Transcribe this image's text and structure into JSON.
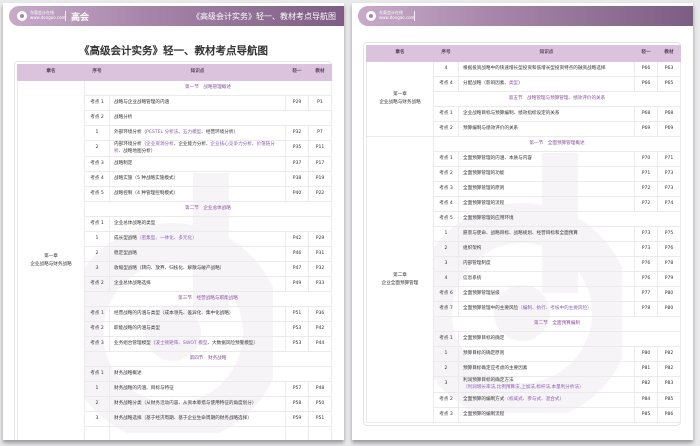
{
  "brand": {
    "logo_text": "东奥会计在线",
    "logo_url_text": "www.dongao.com",
    "level": "高会"
  },
  "header_title": "《高级会计实务》轻一、教材考点导航图",
  "doc_title": "《高级会计实务》轻一、教材考点导航图",
  "columns": [
    "章名",
    "序号",
    "知识点",
    "轻一",
    "教材"
  ],
  "colors": {
    "accent": "#8c5cb5",
    "header_bg": "#dcc3dd"
  },
  "left_page": {
    "chapters": [
      {
        "name": "第一章",
        "sub": "企业战略与财务战略",
        "rows": [
          {
            "sec": "第一节　战略管理概述"
          },
          {
            "n": "考点 1",
            "t": [
              {
                "s": "战略与企业战略管理的内涵"
              }
            ],
            "a": "P29",
            "b": "P1"
          },
          {
            "n": "考点 2",
            "t": [
              {
                "s": "战略分析"
              }
            ]
          },
          {
            "n": "1",
            "t": [
              {
                "s": "外部环境分析（"
              },
              {
                "s": "PESTEL 分析法",
                "h": 1
              },
              {
                "s": "、"
              },
              {
                "s": "五力模型",
                "h": 1
              },
              {
                "s": "、经营环境分析）"
              }
            ],
            "a": "P32",
            "b": "P7"
          },
          {
            "n": "2",
            "t": [
              {
                "s": "内部环境分析（"
              },
              {
                "s": "企业资源分析",
                "h": 1
              },
              {
                "s": "、企业能力分析、"
              },
              {
                "s": "企业核心竞争力分析",
                "h": 1
              },
              {
                "s": "、"
              },
              {
                "s": "价值链分析",
                "h": 1
              },
              {
                "s": "、战略地图分析）"
              }
            ],
            "a": "P35",
            "b": "P11"
          },
          {
            "n": "考点 3",
            "t": [
              {
                "s": "战略制定"
              }
            ],
            "a": "P37",
            "b": "P17"
          },
          {
            "n": "考点 4",
            "t": [
              {
                "s": "战略实施（5 种战略实施模式）"
              }
            ],
            "a": "P38",
            "b": "P19"
          },
          {
            "n": "考点 5",
            "t": [
              {
                "s": "战略控制（4 种管理控制模式）"
              }
            ],
            "a": "P40",
            "b": "P22"
          },
          {
            "sec": "第二节　企业总体战略"
          },
          {
            "n": "考点 1",
            "t": [
              {
                "s": "企业总体战略的类型"
              }
            ]
          },
          {
            "n": "1",
            "t": [
              {
                "s": "成长型战略"
              },
              {
                "s": "（密集型、一体化、多元化）",
                "h": 1
              }
            ],
            "a": "P42",
            "b": "P29"
          },
          {
            "n": "2",
            "t": [
              {
                "s": "稳定型战略"
              }
            ],
            "a": "P46",
            "b": "P31"
          },
          {
            "n": "3",
            "t": [
              {
                "s": "收缩型战略（转向、放弃、归核化、解散与破产战略）"
              }
            ],
            "a": "P47",
            "b": "P32"
          },
          {
            "n": "考点 2",
            "t": [
              {
                "s": "企业总体战略选择"
              }
            ],
            "a": "P49",
            "b": "P33"
          },
          {
            "sec": "第三节　经营战略与职能战略"
          },
          {
            "n": "考点 1",
            "t": [
              {
                "s": "经营战略的内涵与类型（成本领先、差异化、集中化战略）"
              }
            ],
            "a": "P51",
            "b": "P36"
          },
          {
            "n": "考点 2",
            "t": [
              {
                "s": "职能战略的内涵与类型"
              }
            ],
            "a": "P53",
            "b": "P42"
          },
          {
            "n": "考点 3",
            "t": [
              {
                "s": "业务组合管理模型（"
              },
              {
                "s": "波士顿矩阵、SWOT 模型",
                "h": 1
              },
              {
                "s": "、大数据风险预警模型）"
              }
            ],
            "a": "P53",
            "b": "P44"
          },
          {
            "sec": "第四节　财务战略"
          },
          {
            "n": "考点 1",
            "t": [
              {
                "s": "财务战略概述"
              }
            ]
          },
          {
            "n": "1",
            "t": [
              {
                "s": "财务战略的内涵、目标与特征"
              }
            ],
            "a": "P57",
            "b": "P48"
          },
          {
            "n": "2",
            "t": [
              {
                "s": "财务战略分类（从财务活动内容、从资本筹措与使用特征的角度划分）"
              }
            ],
            "a": "P58",
            "b": "P50"
          },
          {
            "n": "3",
            "t": [
              {
                "s": "财务战略选择（基于经济周期、基于企业生命周期的财务战略选择）"
              }
            ],
            "a": "P59",
            "b": "P51"
          },
          {
            "n": "",
            "t": [
              {
                "s": ""
              }
            ],
            "a": "",
            "b": ""
          }
        ]
      }
    ]
  },
  "right_page": {
    "chapters": [
      {
        "name": "第一章",
        "sub": "企业战略与财务战略",
        "rows": [
          {
            "n": "4",
            "t": [
              {
                "s": "根据投资战略中的快速增长型投资和低增长型投资特点的融资战略选择"
              }
            ],
            "a": "P66",
            "b": "P63"
          },
          {
            "n": "考点 4",
            "t": [
              {
                "s": "分配战略（影响因素、"
              },
              {
                "s": "类型",
                "h": 1
              },
              {
                "s": "）"
              }
            ],
            "a": "P66",
            "b": "P65"
          },
          {
            "sec": "第五节　战略管理与预算管理、绩效评价的关系"
          },
          {
            "n": "考点 1",
            "t": [
              {
                "s": "企业战略目标与预算编制、绩效指标设定的关系"
              }
            ],
            "a": "P68",
            "b": "P68"
          },
          {
            "n": "考点 2",
            "t": [
              {
                "s": "预算编制与绩效评价的关系"
              }
            ],
            "a": "P69",
            "b": "P69"
          }
        ]
      },
      {
        "name": "第二章",
        "sub": "企业全面预算管理",
        "rows": [
          {
            "sec": "第一节　全面预算管理概述"
          },
          {
            "n": "考点 1",
            "t": [
              {
                "s": "全面预算管理的内涵、本质与内容"
              }
            ],
            "a": "P70",
            "b": "P71"
          },
          {
            "n": "考点 2",
            "t": [
              {
                "s": "全面预算管理的功能"
              }
            ],
            "a": "P71",
            "b": "P73"
          },
          {
            "n": "考点 3",
            "t": [
              {
                "s": "全面预算管理的原则"
              }
            ],
            "a": "P72",
            "b": "P73"
          },
          {
            "n": "考点 4",
            "t": [
              {
                "s": "全面预算管理的流程"
              }
            ],
            "a": "P72",
            "b": "P74"
          },
          {
            "n": "考点 5",
            "t": [
              {
                "s": "全面预算管理的应用环境"
              }
            ]
          },
          {
            "n": "1",
            "t": [
              {
                "s": "愿景与使命、战略目标、战略规划、经营目标和全面预算"
              }
            ],
            "a": "P73",
            "b": "P75"
          },
          {
            "n": "2",
            "t": [
              {
                "s": "组织架构"
              }
            ],
            "a": "P73",
            "b": "P76"
          },
          {
            "n": "3",
            "t": [
              {
                "s": "内部管理制度"
              }
            ],
            "a": "P76",
            "b": "P78"
          },
          {
            "n": "4",
            "t": [
              {
                "s": "信息系统"
              }
            ],
            "a": "P76",
            "b": "P79"
          },
          {
            "n": "考点 6",
            "t": [
              {
                "s": "全面预算管理层级"
              }
            ],
            "a": "P77",
            "b": "P80"
          },
          {
            "n": "考点 7",
            "t": [
              {
                "s": "全面预算管理中的主要风险"
              },
              {
                "s": "（编制、执行、考核中的主要风险）",
                "h": 1
              }
            ],
            "a": "P78",
            "b": "P80"
          },
          {
            "sec": "第二节　全面预算编制"
          },
          {
            "n": "考点 1",
            "t": [
              {
                "s": "全面预算目标的确定"
              }
            ]
          },
          {
            "n": "1",
            "t": [
              {
                "s": "预算目标的确定原则"
              }
            ],
            "a": "P80",
            "b": "P82"
          },
          {
            "n": "2",
            "t": [
              {
                "s": "预算目标确定应考虑的主要因素"
              }
            ],
            "a": "P81",
            "b": "P82"
          },
          {
            "n": "3",
            "t": [
              {
                "s": "利润预算目标的确定方法"
              },
              {
                "s": "（利润增长率法,比例预算法,上加法,标杆法,本量利分析法）",
                "h": 1
              }
            ],
            "a": "P82",
            "b": "P83"
          },
          {
            "n": "考点 2",
            "t": [
              {
                "s": "全面预算的编制方式"
              },
              {
                "s": "（权威式、参与式、混合式）",
                "h": 1
              }
            ],
            "a": "P84",
            "b": "P85"
          },
          {
            "n": "考点 3",
            "t": [
              {
                "s": "全面预算的编制流程"
              }
            ],
            "a": "P85",
            "b": "P86"
          }
        ]
      }
    ]
  }
}
